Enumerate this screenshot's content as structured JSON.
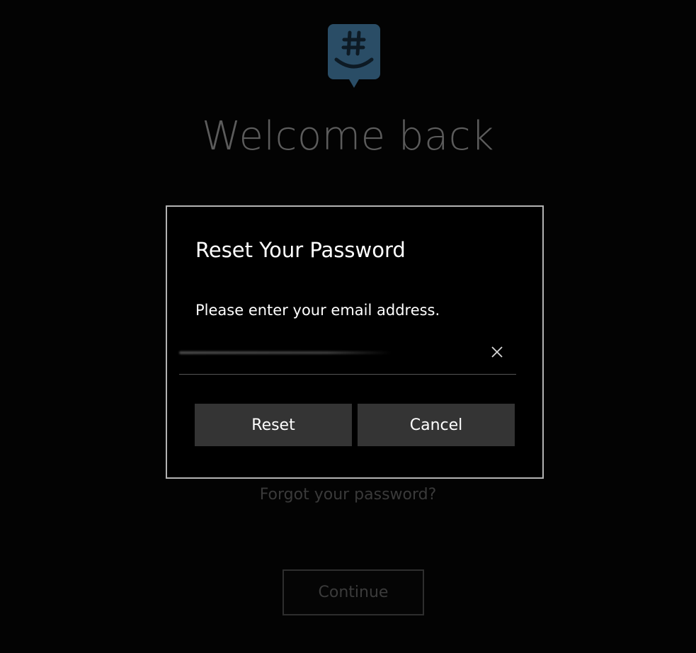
{
  "background": {
    "welcome_title": "Welcome back",
    "forgot_link": "Forgot your password?",
    "continue_label": "Continue"
  },
  "logo": {
    "icon": "groupme-logo-icon",
    "color": "#2a4d66"
  },
  "dialog": {
    "title": "Reset Your Password",
    "message": "Please enter your email address.",
    "email_value": "",
    "clear_icon": "close-icon",
    "reset_label": "Reset",
    "cancel_label": "Cancel"
  },
  "colors": {
    "dialog_border": "#b3b3b3",
    "button_bg": "#343434",
    "dimmed_text": "#5c5c5c"
  }
}
